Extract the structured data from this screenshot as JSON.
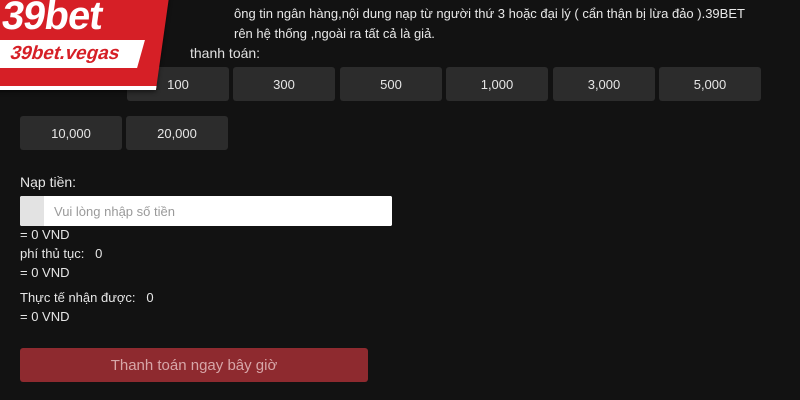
{
  "brand": {
    "logo_main": "39bet",
    "logo_domain": "39bet.vegas",
    "accent": "#d61f26"
  },
  "notice": {
    "line1": "ông tin ngân hàng,nội dung nạp từ người thứ 3 hoặc đại lý ( cẩn thận bị lừa đảo ).39BET",
    "line2": "rên hệ thống ,ngoài ra tất cả là giả."
  },
  "amounts": {
    "label": "thanh toán:",
    "options": [
      "100",
      "300",
      "500",
      "1,000",
      "3,000",
      "5,000",
      "10,000",
      "20,000"
    ]
  },
  "deposit": {
    "label": "Nạp tiền:",
    "placeholder": "Vui lòng nhập số tiền",
    "value": "",
    "converted": "= 0 VND"
  },
  "fee": {
    "label": "phí thủ tục:",
    "value": "0",
    "converted": "= 0 VND"
  },
  "actual": {
    "label": "Thực tế nhận được:",
    "value": "0",
    "converted": "= 0 VND"
  },
  "submit": {
    "label": "Thanh toán ngay bây giờ",
    "color": "#8e2a2f"
  }
}
